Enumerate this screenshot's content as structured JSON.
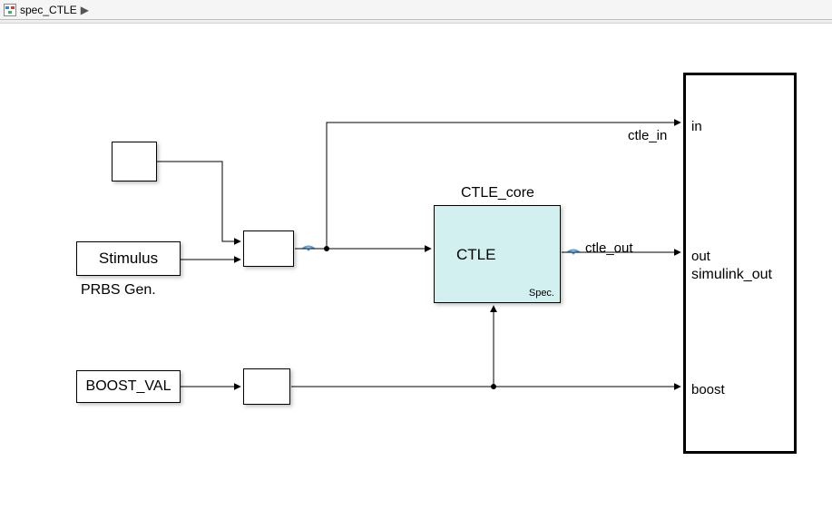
{
  "toolbar": {
    "model_name": "spec_CTLE",
    "breadcrumb_sep": "▶"
  },
  "blocks": {
    "step_source": {},
    "stimulus": {
      "label": "Stimulus",
      "caption": "PRBS Gen."
    },
    "boost_val": {
      "label": "BOOST_VAL"
    },
    "switch": {},
    "bus_creator": {},
    "ctle_core": {
      "title": "CTLE_core",
      "inside_label": "CTLE",
      "spec_label": "Spec."
    },
    "outport": {
      "name": "simulink_out",
      "ports": {
        "in": "in",
        "out": "out",
        "boost": "boost"
      }
    }
  },
  "signals": {
    "ctle_in": "ctle_in",
    "ctle_out": "ctle_out"
  }
}
